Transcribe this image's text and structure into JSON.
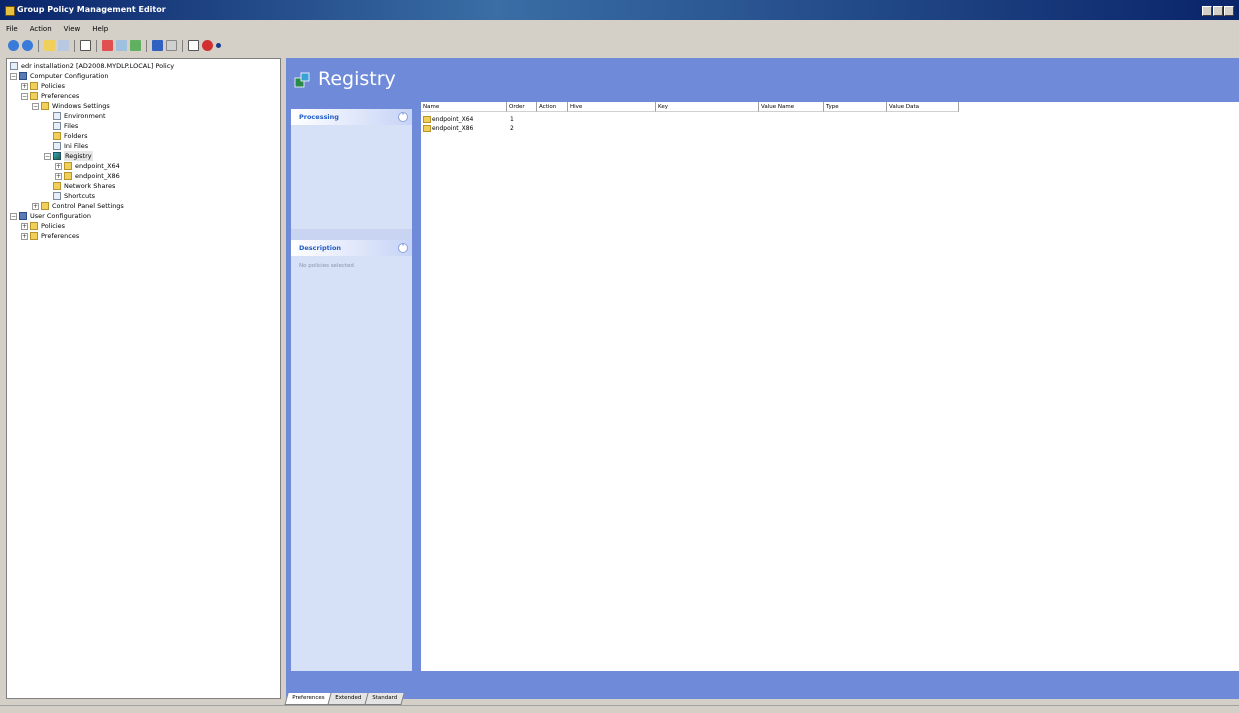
{
  "window": {
    "title": "Group Policy Management Editor"
  },
  "menu": [
    "File",
    "Action",
    "View",
    "Help"
  ],
  "tree": {
    "root": "edr installation2 [AD2008.MYDLP.LOCAL] Policy",
    "computer_config": "Computer Configuration",
    "cc_policies": "Policies",
    "cc_preferences": "Preferences",
    "windows_settings": "Windows Settings",
    "environment": "Environment",
    "files": "Files",
    "folders": "Folders",
    "ini_files": "Ini Files",
    "registry": "Registry",
    "endpoint_x64": "endpoint_X64",
    "endpoint_x86": "endpoint_X86",
    "network_shares": "Network Shares",
    "shortcuts": "Shortcuts",
    "control_panel": "Control Panel Settings",
    "user_config": "User Configuration",
    "uc_policies": "Policies",
    "uc_preferences": "Preferences"
  },
  "banner": {
    "title": "Registry"
  },
  "taskpane": {
    "processing_title": "Processing",
    "description_title": "Description",
    "description_text": "No policies selected"
  },
  "listview": {
    "columns": [
      "Name",
      "Order",
      "Action",
      "Hive",
      "Key",
      "Value Name",
      "Type",
      "Value Data"
    ],
    "rows": [
      {
        "name": "endpoint_X64",
        "order": "1"
      },
      {
        "name": "endpoint_X86",
        "order": "2"
      }
    ]
  },
  "tabs": [
    "Preferences",
    "Extended",
    "Standard"
  ],
  "colors": {
    "banner": "#6f8ad8",
    "titlebar": "#0a246a",
    "section_title": "#215dc6"
  }
}
